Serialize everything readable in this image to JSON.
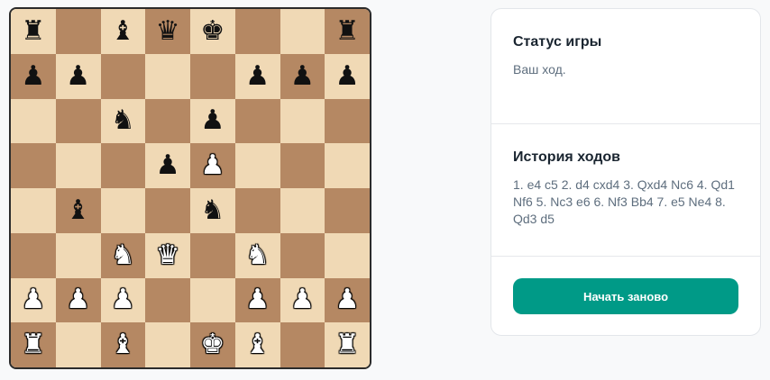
{
  "board": {
    "light_color": "#f0d9b5",
    "dark_color": "#b58863",
    "rows": [
      [
        "bR",
        "",
        "bB",
        "bQ",
        "bK",
        "",
        "",
        "bR"
      ],
      [
        "bP",
        "bP",
        "",
        "",
        "",
        "bP",
        "bP",
        "bP"
      ],
      [
        "",
        "",
        "bN",
        "",
        "bP",
        "",
        "",
        ""
      ],
      [
        "",
        "",
        "",
        "bP",
        "wP",
        "",
        "",
        ""
      ],
      [
        "",
        "bB",
        "",
        "",
        "bN",
        "",
        "",
        ""
      ],
      [
        "",
        "",
        "wN",
        "wQ",
        "",
        "wN",
        "",
        ""
      ],
      [
        "wP",
        "wP",
        "wP",
        "",
        "",
        "wP",
        "wP",
        "wP"
      ],
      [
        "wR",
        "",
        "wB",
        "",
        "wK",
        "wB",
        "",
        "wR"
      ]
    ]
  },
  "status": {
    "title": "Статус игры",
    "text": "Ваш ход."
  },
  "history": {
    "title": "История ходов",
    "text": "1. e4 c5 2. d4 cxd4 3. Qxd4 Nc6 4. Qd1 Nf6 5. Nc3 e6 6. Nf3 Bb4 7. e5 Ne4 8. Qd3 d5"
  },
  "actions": {
    "restart_label": "Начать заново",
    "accent_color": "#009a87"
  }
}
